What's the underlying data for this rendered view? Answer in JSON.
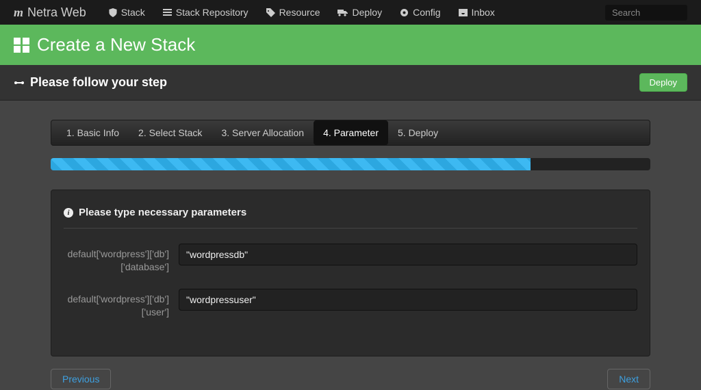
{
  "brand": {
    "name": "Netra Web"
  },
  "nav": {
    "items": [
      {
        "label": "Stack",
        "icon": "shield-icon"
      },
      {
        "label": "Stack Repository",
        "icon": "list-icon"
      },
      {
        "label": "Resource",
        "icon": "tag-icon"
      },
      {
        "label": "Deploy",
        "icon": "truck-icon"
      },
      {
        "label": "Config",
        "icon": "gear-icon"
      },
      {
        "label": "Inbox",
        "icon": "inbox-icon"
      }
    ],
    "search_placeholder": "Search"
  },
  "header": {
    "title": "Create a New Stack"
  },
  "subheader": {
    "title": "Please follow your step",
    "deploy_label": "Deploy"
  },
  "steps": {
    "tabs": [
      {
        "label": "1. Basic Info",
        "active": false
      },
      {
        "label": "2. Select Stack",
        "active": false
      },
      {
        "label": "3. Server Allocation",
        "active": false
      },
      {
        "label": "4. Parameter",
        "active": true
      },
      {
        "label": "5. Deploy",
        "active": false
      }
    ],
    "progress_percent": 80
  },
  "panel": {
    "title": "Please type necessary parameters",
    "fields": [
      {
        "label": "default['wordpress']['db']['database']",
        "value": "\"wordpressdb\""
      },
      {
        "label": "default['wordpress']['db']['user']",
        "value": "\"wordpressuser\""
      }
    ]
  },
  "footer": {
    "prev_label": "Previous",
    "next_label": "Next"
  }
}
